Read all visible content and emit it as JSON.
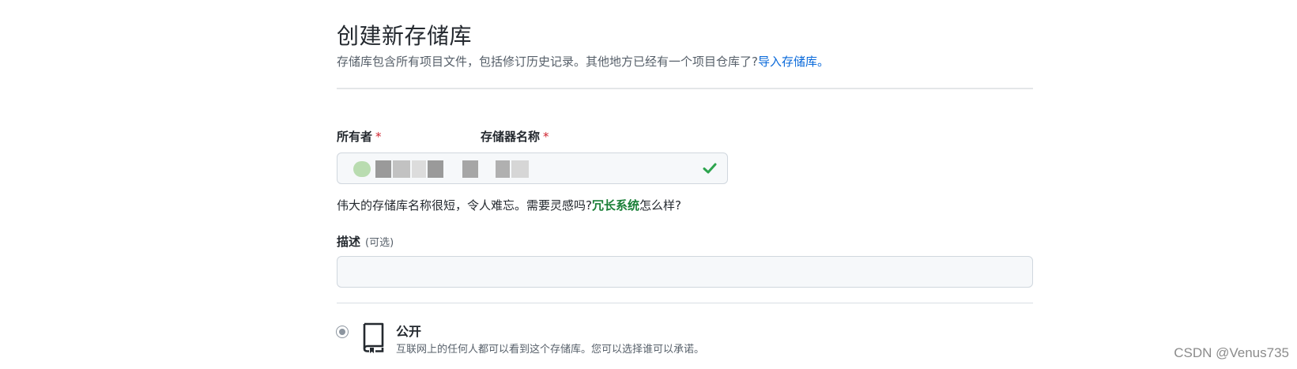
{
  "header": {
    "title": "创建新存储库",
    "subtitle": "存储库包含所有项目文件，包括修订历史记录。其他地方已经有一个项目仓库了?",
    "import_link": "导入存储库。"
  },
  "form": {
    "owner_label": "所有者",
    "required_mark": "*",
    "repo_name_label": "存储器名称",
    "hint_prefix": "伟大的存储库名称很短，令人难忘。需要灵感吗?",
    "hint_suggestion": "冗长系统",
    "hint_suffix": "怎么样?",
    "description_label": "描述",
    "description_optional": "(可选)",
    "description_value": ""
  },
  "visibility": {
    "public_label": "公开",
    "public_description": "互联网上的任何人都可以看到这个存储库。您可以选择谁可以承诺。"
  },
  "watermark": "CSDN @Venus735",
  "colors": {
    "link": "#0969da",
    "suggestion": "#1a7f37",
    "required": "#cf222e",
    "check": "#2da44e"
  },
  "icons": {
    "valid": "check-icon",
    "repository": "repo-icon"
  }
}
